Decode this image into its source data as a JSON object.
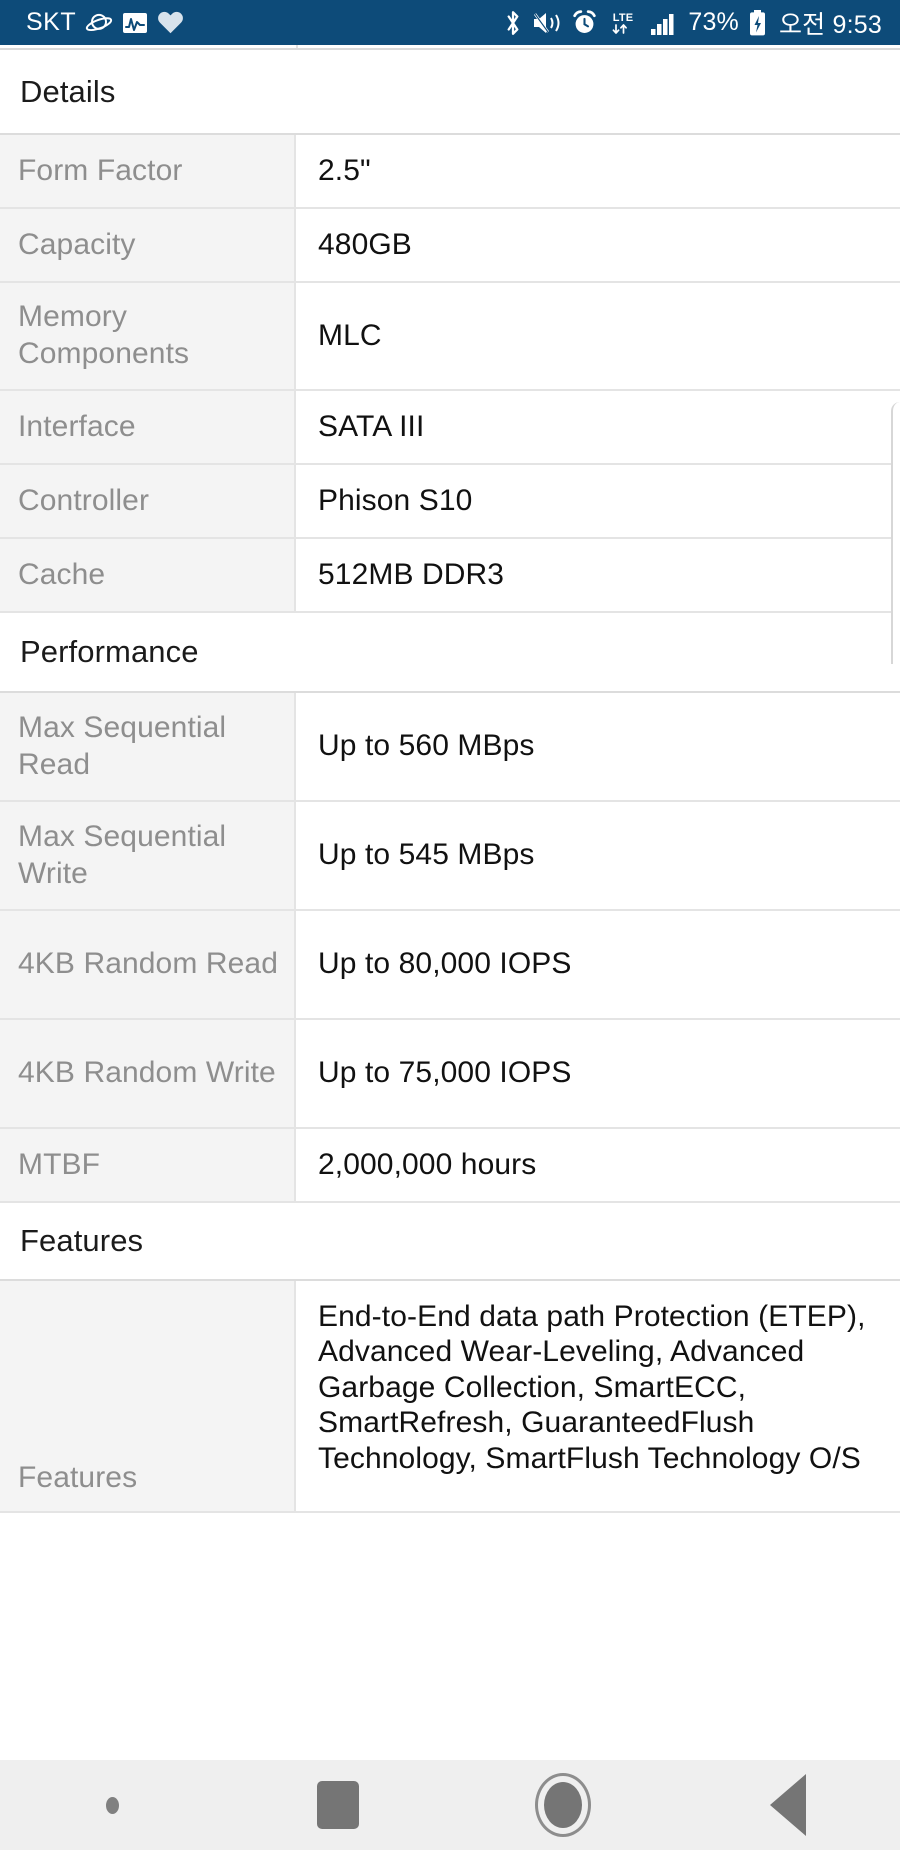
{
  "statusbar": {
    "carrier": "SKT",
    "left_icons": [
      "saturn-icon",
      "activity-chart-icon",
      "heart-icon"
    ],
    "right_icons": [
      "bluetooth-icon",
      "mute-vibrate-icon",
      "alarm-clock-icon",
      "lte-data-icon",
      "signal-bars-icon"
    ],
    "lte_label": "LTE",
    "battery_percent": "73%",
    "battery_state": "charging",
    "clock": "오전 9:53",
    "background_color": "#0d4b79",
    "foreground_color": "#ffffff"
  },
  "sections": [
    {
      "id": "details",
      "title": "Details",
      "rows": [
        {
          "label": "Form Factor",
          "value": "2.5\""
        },
        {
          "label": "Capacity",
          "value": "480GB"
        },
        {
          "label": "Memory Components",
          "value": "MLC"
        },
        {
          "label": "Interface",
          "value": "SATA III"
        },
        {
          "label": "Controller",
          "value": "Phison S10"
        },
        {
          "label": "Cache",
          "value": "512MB DDR3"
        }
      ]
    },
    {
      "id": "performance",
      "title": "Performance",
      "rows": [
        {
          "label": "Max Sequential Read",
          "value": "Up to 560 MBps"
        },
        {
          "label": "Max Sequential Write",
          "value": "Up to 545 MBps"
        },
        {
          "label": "4KB Random Read",
          "value": "Up to 80,000 IOPS"
        },
        {
          "label": "4KB Random Write",
          "value": "Up to 75,000 IOPS"
        },
        {
          "label": "MTBF",
          "value": "2,000,000 hours"
        }
      ]
    },
    {
      "id": "features",
      "title": "Features",
      "rows": [
        {
          "label": "Features",
          "value": "End-to-End data path Protection (ETEP), Advanced Wear-Leveling, Advanced Garbage Collection, SmartECC, SmartRefresh, GuaranteedFlush Technology, SmartFlush Technology O/S"
        }
      ]
    }
  ],
  "navbar": {
    "items": [
      {
        "name": "notification-dot",
        "label": ""
      },
      {
        "name": "recents-button",
        "label": ""
      },
      {
        "name": "home-button",
        "label": ""
      },
      {
        "name": "back-button",
        "label": ""
      }
    ],
    "background_color": "#efefef"
  },
  "colors": {
    "label_bg": "#f4f4f4",
    "label_text": "#8e8e8e",
    "value_text": "#111111",
    "border": "#e4e4e4"
  }
}
